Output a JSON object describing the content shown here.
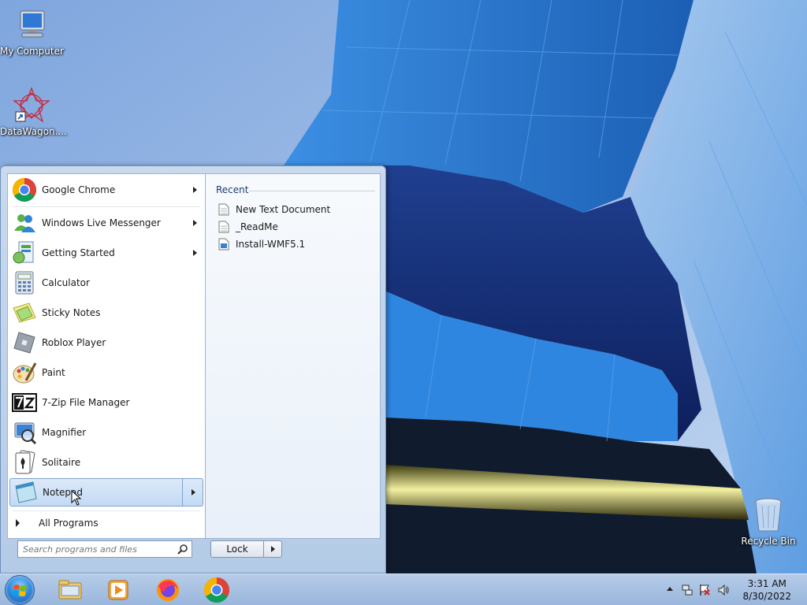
{
  "desktop": {
    "icons": [
      {
        "label": "My Computer",
        "icon": "computer-icon"
      },
      {
        "label": "DataWagon....",
        "icon": "datawagon-shortcut-icon"
      },
      {
        "label": "Recycle Bin",
        "icon": "recycle-bin-icon"
      }
    ]
  },
  "start_menu": {
    "programs": [
      {
        "label": "Google Chrome",
        "icon": "chrome-icon",
        "has_submenu": true
      },
      {
        "label": "Windows Live Messenger",
        "icon": "messenger-icon",
        "has_submenu": true
      },
      {
        "label": "Getting Started",
        "icon": "getting-started-icon",
        "has_submenu": true
      },
      {
        "label": "Calculator",
        "icon": "calculator-icon",
        "has_submenu": false
      },
      {
        "label": "Sticky Notes",
        "icon": "sticky-notes-icon",
        "has_submenu": false
      },
      {
        "label": "Roblox Player",
        "icon": "roblox-icon",
        "has_submenu": false
      },
      {
        "label": "Paint",
        "icon": "paint-icon",
        "has_submenu": false
      },
      {
        "label": "7-Zip File Manager",
        "icon": "7zip-icon",
        "has_submenu": false
      },
      {
        "label": "Magnifier",
        "icon": "magnifier-icon",
        "has_submenu": false
      },
      {
        "label": "Solitaire",
        "icon": "solitaire-icon",
        "has_submenu": false
      },
      {
        "label": "Notepad",
        "icon": "notepad-icon",
        "has_submenu": true,
        "highlighted": true
      }
    ],
    "all_programs_label": "All Programs",
    "recent_title": "Recent",
    "recent_items": [
      {
        "label": "New Text Document",
        "icon": "text-document-icon"
      },
      {
        "label": "_ReadMe",
        "icon": "text-document-icon"
      },
      {
        "label": "Install-WMF5.1",
        "icon": "script-document-icon"
      }
    ],
    "search_placeholder": "Search programs and files",
    "lock_label": "Lock"
  },
  "taskbar": {
    "pinned": [
      "explorer-icon",
      "media-player-icon",
      "firefox-icon",
      "chrome-icon"
    ],
    "tray_icons": [
      "show-hidden-icons-icon",
      "network-icon",
      "action-center-icon",
      "volume-icon"
    ],
    "time": "3:31 AM",
    "date": "8/30/2022"
  },
  "colors": {
    "sky": "#8fb4e4",
    "building_blue": "#2f7fd6",
    "start_menu_frame": "#c9d9ee",
    "highlight": "#c3daf4"
  }
}
